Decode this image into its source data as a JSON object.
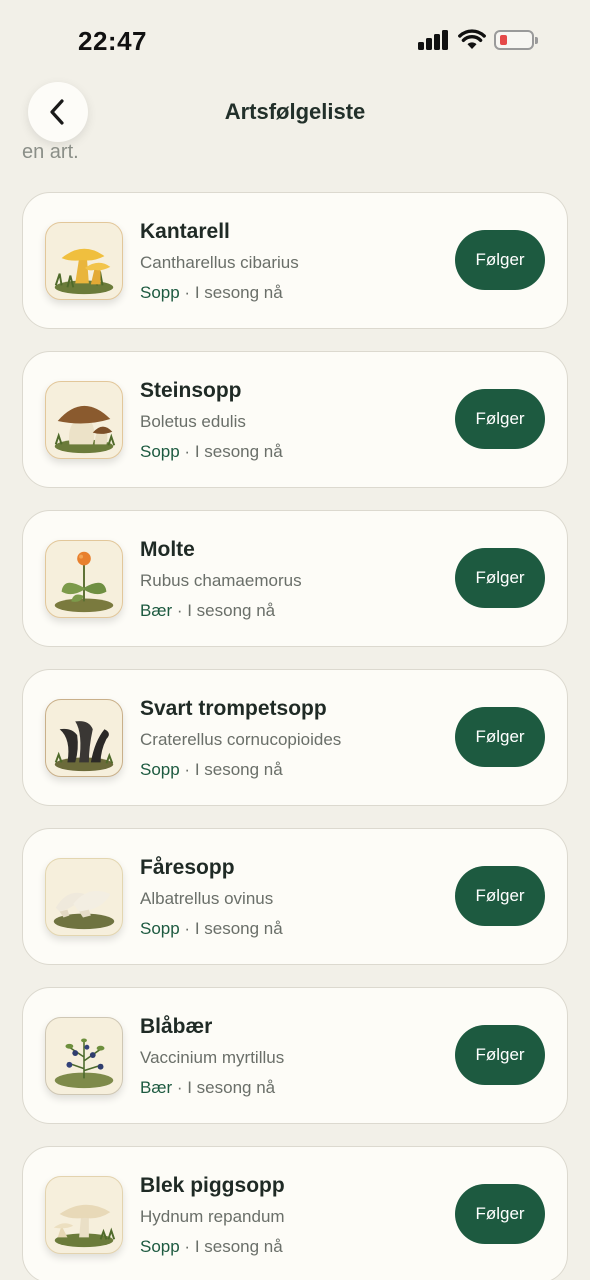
{
  "status_bar": {
    "time": "22:47",
    "battery_color": "#e54848"
  },
  "nav": {
    "back_icon": "chevron-left-icon",
    "title": "Artsfølgeliste"
  },
  "cut_text": "en art.",
  "accent_color": "#1d5a40",
  "species": [
    {
      "name": "Kantarell",
      "latin": "Cantharellus cibarius",
      "category": "Sopp",
      "season": "I sesong nå",
      "button": "Følger",
      "illustration": "chanterelle-illustration"
    },
    {
      "name": "Steinsopp",
      "latin": "Boletus edulis",
      "category": "Sopp",
      "season": "I sesong nå",
      "button": "Følger",
      "illustration": "porcini-illustration"
    },
    {
      "name": "Molte",
      "latin": "Rubus chamaemorus",
      "category": "Bær",
      "season": "I sesong nå",
      "button": "Følger",
      "illustration": "cloudberry-illustration"
    },
    {
      "name": "Svart trompetsopp",
      "latin": "Craterellus cornucopioides",
      "category": "Sopp",
      "season": "I sesong nå",
      "button": "Følger",
      "illustration": "black-trumpet-illustration"
    },
    {
      "name": "Fåresopp",
      "latin": "Albatrellus ovinus",
      "category": "Sopp",
      "season": "I sesong nå",
      "button": "Følger",
      "illustration": "sheep-polypore-illustration"
    },
    {
      "name": "Blåbær",
      "latin": "Vaccinium myrtillus",
      "category": "Bær",
      "season": "I sesong nå",
      "button": "Følger",
      "illustration": "blueberry-illustration"
    },
    {
      "name": "Blek piggsopp",
      "latin": "Hydnum repandum",
      "category": "Sopp",
      "season": "I sesong nå",
      "button": "Følger",
      "illustration": "hedgehog-mushroom-illustration"
    }
  ]
}
